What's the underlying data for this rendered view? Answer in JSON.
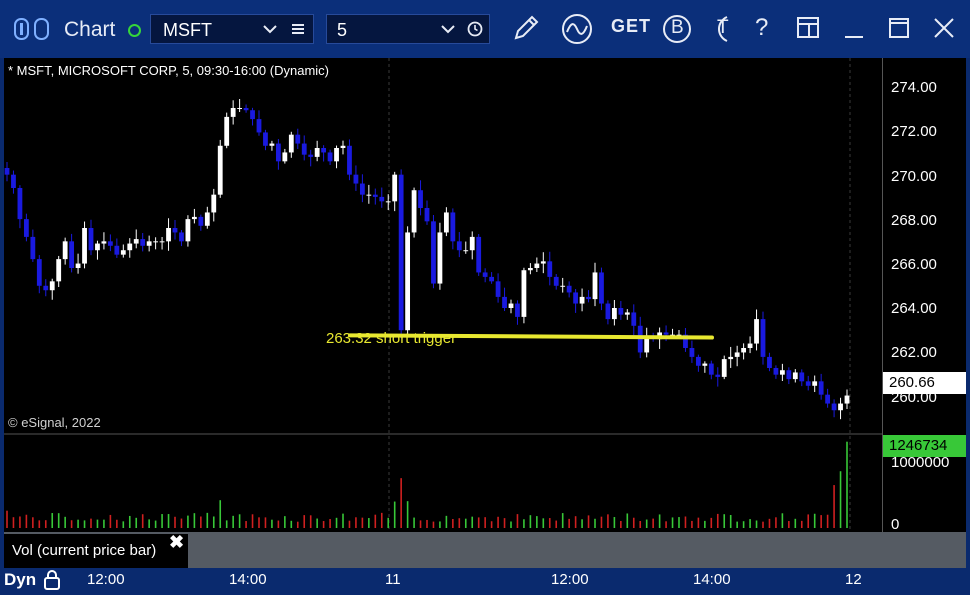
{
  "titlebar": {
    "title": "Chart",
    "symbol": "MSFT",
    "interval": "5",
    "icons": [
      "brand-chart-icon",
      "dropdown-chevron-icon",
      "list-icon",
      "clock-icon",
      "pencil-icon",
      "study-wave-icon",
      "get-icon",
      "b-circle-icon",
      "t-circle-icon",
      "help-icon",
      "window-layout-icon",
      "minimize-icon",
      "maximize-icon",
      "close-icon"
    ],
    "get_label": "GET",
    "b_label": "B",
    "t_label": "T",
    "help_label": "?"
  },
  "chart": {
    "info": "* MSFT, MICROSOFT CORP, 5, 09:30-16:00 (Dynamic)",
    "copyright": "© eSignal, 2022",
    "price_ticks": [
      "274.00",
      "272.00",
      "270.00",
      "268.00",
      "266.00",
      "264.00",
      "262.00",
      "260.00"
    ],
    "last_price": "260.66",
    "volume_ticks": [
      "1000000",
      "0"
    ],
    "last_volume": "1246734",
    "volume_panel_label": "Vol (current price bar)",
    "volume_close": "✖",
    "time_axis_lock": "Dyn",
    "time_ticks": [
      "12:00",
      "14:00",
      "11",
      "12:00",
      "14:00",
      "12"
    ],
    "annotation": "263.32 short trigger",
    "colors": {
      "up": "#ffffff",
      "down": "#1a1ae0",
      "trendline": "#e8e830",
      "vol_up": "#38c838",
      "vol_down": "#d02020"
    }
  },
  "chart_data": {
    "type": "candlestick",
    "symbol": "MSFT",
    "interval": "5",
    "ylim": [
      259.2,
      275.4
    ],
    "volume_ylim": [
      0,
      1300000
    ],
    "last_price": 260.66,
    "last_volume": 1246734,
    "horizontal_line": {
      "value": 263.32,
      "label": "263.32 short trigger"
    },
    "closes": [
      270.6,
      270.0,
      268.6,
      267.8,
      266.8,
      265.6,
      265.4,
      265.8,
      266.8,
      267.6,
      266.4,
      266.6,
      268.2,
      267.2,
      267.5,
      267.6,
      267.4,
      267.0,
      267.2,
      267.5,
      267.7,
      267.4,
      267.6,
      267.6,
      267.6,
      268.2,
      268.0,
      267.6,
      268.6,
      268.7,
      268.3,
      268.9,
      269.7,
      271.9,
      273.2,
      273.6,
      273.6,
      273.5,
      273.1,
      272.5,
      271.9,
      272.0,
      271.2,
      271.6,
      272.4,
      272.0,
      271.5,
      271.4,
      271.8,
      271.6,
      271.2,
      271.8,
      271.9,
      270.6,
      270.2,
      269.7,
      269.7,
      269.6,
      269.4,
      269.4,
      270.6,
      263.6,
      268.0,
      269.9,
      269.1,
      268.5,
      265.7,
      268.0,
      268.9,
      267.6,
      267.2,
      267.2,
      267.8,
      266.2,
      266.0,
      265.8,
      265.1,
      264.6,
      264.8,
      264.2,
      266.3,
      266.4,
      266.6,
      266.7,
      266.0,
      265.6,
      265.6,
      265.3,
      264.8,
      265.1,
      265.0,
      266.2,
      264.8,
      264.1,
      264.6,
      264.3,
      264.4,
      263.8,
      262.6,
      263.3,
      263.2,
      263.5,
      263.4,
      263.4,
      263.4,
      262.8,
      262.4,
      262.0,
      262.1,
      261.6,
      261.5,
      262.3,
      262.4,
      262.6,
      262.8,
      263.0,
      264.1,
      262.4,
      261.9,
      261.6,
      261.8,
      261.4,
      261.7,
      261.3,
      261.1,
      261.3,
      260.7,
      260.3,
      260.0,
      260.3,
      260.66
    ],
    "x_ticks": [
      "12:00",
      "14:00",
      "11",
      "12:00",
      "14:00",
      "12"
    ],
    "price_axis_ticks": [
      274,
      272,
      270,
      268,
      266,
      264,
      262,
      260
    ],
    "volume_axis_ticks": [
      1000000,
      0
    ],
    "grid": false
  }
}
